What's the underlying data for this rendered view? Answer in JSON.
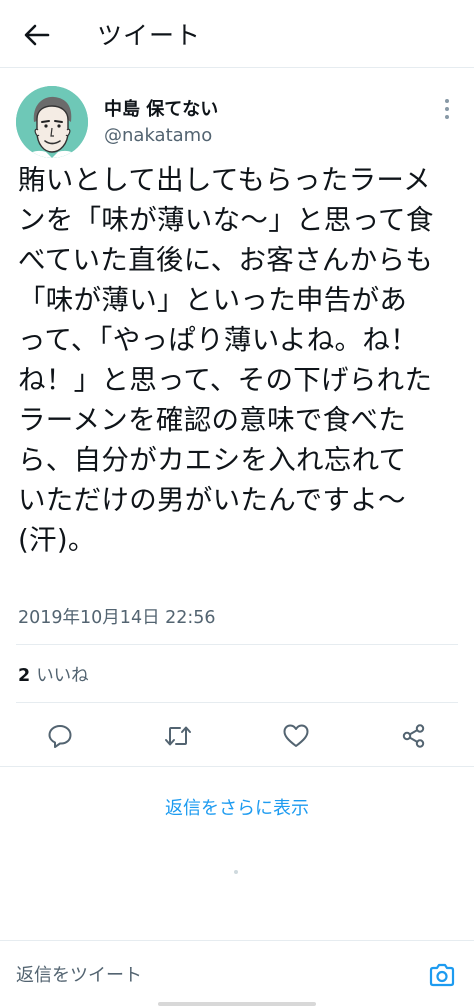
{
  "header": {
    "title": "ツイート"
  },
  "author": {
    "name": "中島 保てない",
    "handle": "@nakatamo"
  },
  "tweet": {
    "lines": [
      "賄いとして出してもらったラーメ",
      "ンを「味が薄いな～」と思って食",
      "べていた直後に、お客さんからも",
      "「味が薄い」といった申告があ",
      "って、「やっぱり薄いよね。ね！",
      "ね！」と思って、その下げられた",
      "ラーメンを確認の意味で食べた",
      "ら、自分がカエシを入れ忘れて",
      "いただけの男がいたんですよ～",
      "(汗)。"
    ],
    "timestamp": "2019年10月14日 22:56"
  },
  "stats": {
    "like_count": "2",
    "like_label": "いいね"
  },
  "actions": {
    "reply_icon": "reply-icon",
    "retweet_icon": "retweet-icon",
    "like_icon": "heart-icon",
    "share_icon": "share-icon"
  },
  "replies": {
    "show_more_label": "返信をさらに表示"
  },
  "compose": {
    "placeholder": "返信をツイート"
  },
  "colors": {
    "accent": "#1d9bf0",
    "secondary_text": "#536471",
    "divider": "#e6ecf0"
  }
}
